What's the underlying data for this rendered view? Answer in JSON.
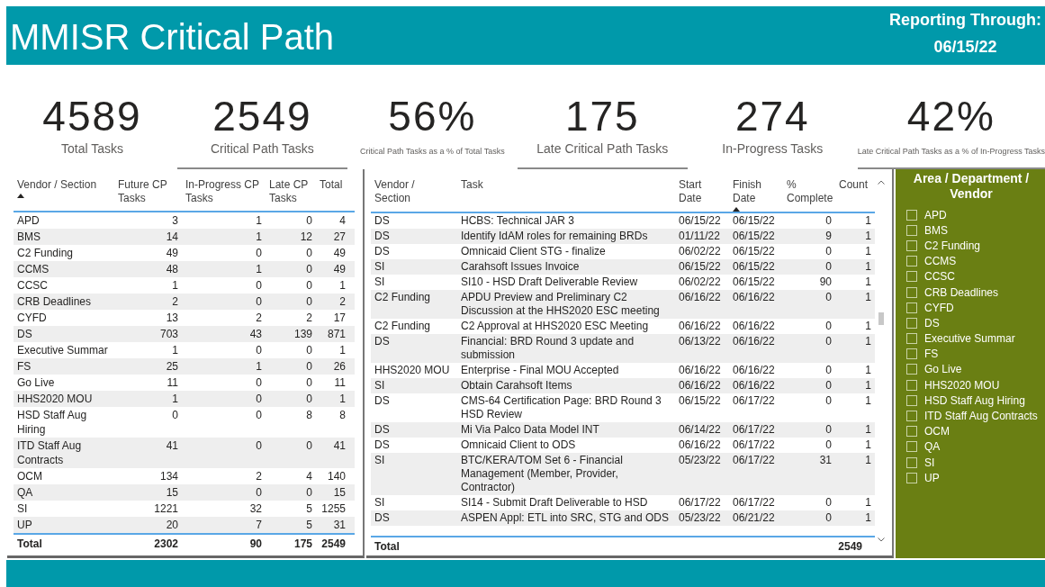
{
  "header": {
    "title": "MMISR Critical Path",
    "reporting_label": "Reporting Through:",
    "reporting_date": "06/15/22"
  },
  "kpis": [
    {
      "value": "4589",
      "label": "Total Tasks",
      "kind": "large"
    },
    {
      "value": "2549",
      "label": "Critical Path Tasks",
      "kind": "large"
    },
    {
      "value": "56%",
      "label": "Critical Path Tasks as a % of Total Tasks",
      "kind": "small"
    },
    {
      "value": "175",
      "label": "Late Critical Path Tasks",
      "kind": "large"
    },
    {
      "value": "274",
      "label": "In-Progress Tasks",
      "kind": "large"
    },
    {
      "value": "42%",
      "label": "Late Critical Path Tasks as a % of In-Progress Tasks",
      "kind": "small"
    }
  ],
  "vendor_table": {
    "columns": [
      {
        "label": "Vendor / Section",
        "sorted": true
      },
      {
        "label": "Future CP Tasks",
        "sorted": false
      },
      {
        "label": "In-Progress CP Tasks",
        "sorted": false
      },
      {
        "label": "Late CP Tasks",
        "sorted": false
      },
      {
        "label": "Total",
        "sorted": false
      }
    ],
    "rows": [
      [
        "APD",
        "3",
        "1",
        "0",
        "4"
      ],
      [
        "BMS",
        "14",
        "1",
        "12",
        "27"
      ],
      [
        "C2 Funding",
        "49",
        "0",
        "0",
        "49"
      ],
      [
        "CCMS",
        "48",
        "1",
        "0",
        "49"
      ],
      [
        "CCSC",
        "1",
        "0",
        "0",
        "1"
      ],
      [
        "CRB Deadlines",
        "2",
        "0",
        "0",
        "2"
      ],
      [
        "CYFD",
        "13",
        "2",
        "2",
        "17"
      ],
      [
        "DS",
        "703",
        "43",
        "139",
        "871"
      ],
      [
        "Executive Summar",
        "1",
        "0",
        "0",
        "1"
      ],
      [
        "FS",
        "25",
        "1",
        "0",
        "26"
      ],
      [
        "Go Live",
        "11",
        "0",
        "0",
        "11"
      ],
      [
        "HHS2020 MOU",
        "1",
        "0",
        "0",
        "1"
      ],
      [
        "HSD Staff Aug Hiring",
        "0",
        "0",
        "8",
        "8"
      ],
      [
        "ITD Staff Aug Contracts",
        "41",
        "0",
        "0",
        "41"
      ],
      [
        "OCM",
        "134",
        "2",
        "4",
        "140"
      ],
      [
        "QA",
        "15",
        "0",
        "0",
        "15"
      ],
      [
        "SI",
        "1221",
        "32",
        "5",
        "1255"
      ],
      [
        "UP",
        "20",
        "7",
        "5",
        "31"
      ]
    ],
    "total": [
      "Total",
      "2302",
      "90",
      "175",
      "2549"
    ]
  },
  "task_table": {
    "columns": [
      {
        "label": "Vendor / Section",
        "sorted": false
      },
      {
        "label": "Task",
        "sorted": false
      },
      {
        "label": "Start Date",
        "sorted": false
      },
      {
        "label": "Finish Date",
        "sorted": true
      },
      {
        "label": "% Complete",
        "sorted": false
      },
      {
        "label": "Count",
        "sorted": false
      }
    ],
    "rows": [
      [
        "DS",
        "HCBS: Technical JAR 3",
        "06/15/22",
        "06/15/22",
        "0",
        "1"
      ],
      [
        "DS",
        "Identify IdAM roles for remaining BRDs",
        "01/11/22",
        "06/15/22",
        "9",
        "1"
      ],
      [
        "DS",
        "Omnicaid Client STG - finalize",
        "06/02/22",
        "06/15/22",
        "0",
        "1"
      ],
      [
        "SI",
        "Carahsoft Issues Invoice",
        "06/15/22",
        "06/15/22",
        "0",
        "1"
      ],
      [
        "SI",
        "SI10 - HSD Draft Deliverable Review",
        "06/02/22",
        "06/15/22",
        "90",
        "1"
      ],
      [
        "C2 Funding",
        "APDU Preview and Preliminary C2 Discussion at the HHS2020 ESC meeting",
        "06/16/22",
        "06/16/22",
        "0",
        "1"
      ],
      [
        "C2 Funding",
        "C2 Approval at HHS2020 ESC Meeting",
        "06/16/22",
        "06/16/22",
        "0",
        "1"
      ],
      [
        "DS",
        "Financial: BRD Round 3 update and submission",
        "06/13/22",
        "06/16/22",
        "0",
        "1"
      ],
      [
        "HHS2020 MOU",
        "Enterprise - Final MOU Accepted",
        "06/16/22",
        "06/16/22",
        "0",
        "1"
      ],
      [
        "SI",
        "Obtain Carahsoft Items",
        "06/16/22",
        "06/16/22",
        "0",
        "1"
      ],
      [
        "DS",
        "CMS-64 Certification Page: BRD Round 3 HSD Review",
        "06/15/22",
        "06/17/22",
        "0",
        "1"
      ],
      [
        "DS",
        "Mi Via Palco Data Model INT",
        "06/14/22",
        "06/17/22",
        "0",
        "1"
      ],
      [
        "DS",
        "Omnicaid Client to ODS",
        "06/16/22",
        "06/17/22",
        "0",
        "1"
      ],
      [
        "SI",
        "BTC/KERA/TOM Set 6 - Financial Management (Member, Provider, Contractor)",
        "05/23/22",
        "06/17/22",
        "31",
        "1"
      ],
      [
        "SI",
        "SI14 - Submit Draft Deliverable to HSD",
        "06/17/22",
        "06/17/22",
        "0",
        "1"
      ],
      [
        "DS",
        "ASPEN Appl: ETL into SRC, STG and ODS",
        "05/23/22",
        "06/21/22",
        "0",
        "1"
      ]
    ],
    "total": {
      "label": "Total",
      "value": "2549"
    }
  },
  "slicer": {
    "title": "Area / Department / Vendor",
    "items": [
      {
        "label": "APD",
        "checked": false
      },
      {
        "label": "BMS",
        "checked": false
      },
      {
        "label": "C2 Funding",
        "checked": false
      },
      {
        "label": "CCMS",
        "checked": false
      },
      {
        "label": "CCSC",
        "checked": false
      },
      {
        "label": "CRB Deadlines",
        "checked": false
      },
      {
        "label": "CYFD",
        "checked": false
      },
      {
        "label": "DS",
        "checked": false
      },
      {
        "label": "Executive Summar",
        "checked": false
      },
      {
        "label": "FS",
        "checked": false
      },
      {
        "label": "Go Live",
        "checked": false
      },
      {
        "label": "HHS2020 MOU",
        "checked": false
      },
      {
        "label": "HSD Staff Aug Hiring",
        "checked": false
      },
      {
        "label": "ITD Staff Aug Contracts",
        "checked": false
      },
      {
        "label": "OCM",
        "checked": false
      },
      {
        "label": "QA",
        "checked": false
      },
      {
        "label": "SI",
        "checked": false
      },
      {
        "label": "UP",
        "checked": false
      }
    ]
  }
}
